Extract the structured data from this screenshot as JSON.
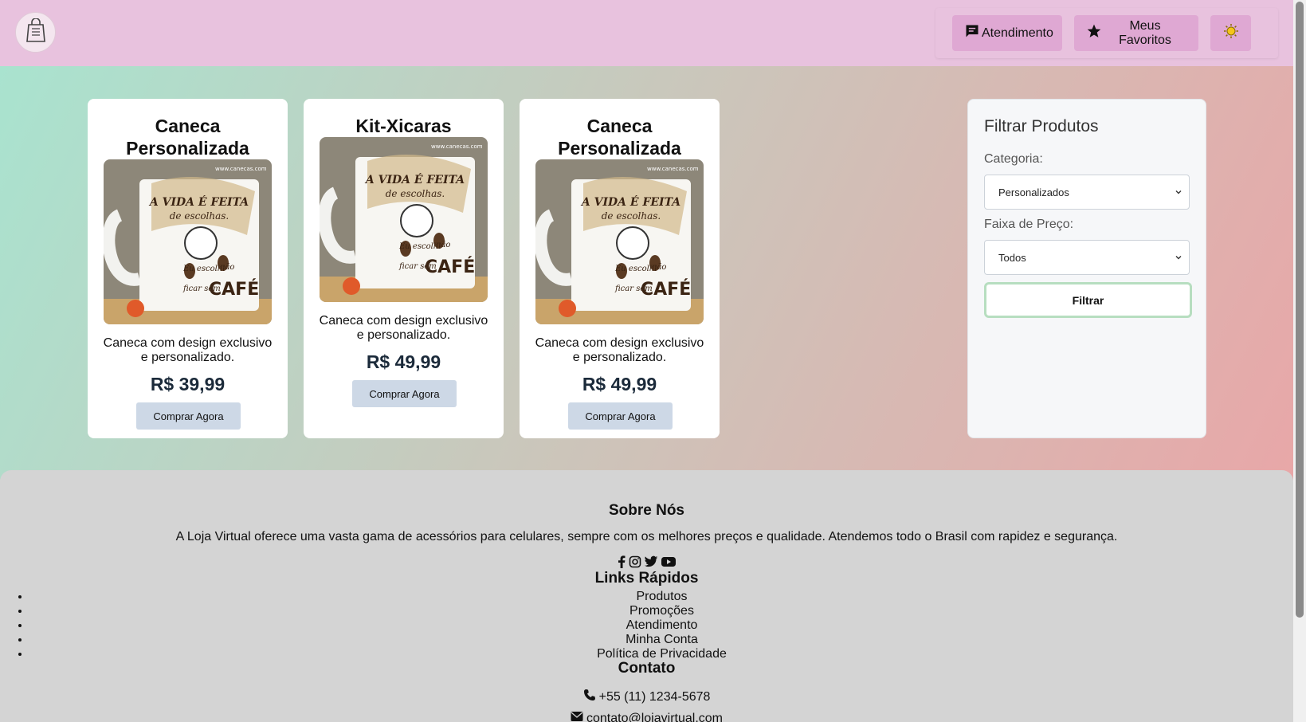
{
  "header": {
    "logo_icon": "shopping-bag-icon",
    "nav": [
      {
        "label": "Atendimento",
        "icon": "chat-icon"
      },
      {
        "label": "Meus Favoritos",
        "icon": "star-icon"
      },
      {
        "label": "",
        "icon": "sun-icon"
      }
    ]
  },
  "products": [
    {
      "title": "Caneca Personalizada",
      "description": "Caneca com design exclusivo e personalizado.",
      "price": "R$ 39,99",
      "button": "Comprar Agora"
    },
    {
      "title": "Kit-Xicaras",
      "description": "Caneca com design exclusivo e personalizado.",
      "price": "R$ 49,99",
      "button": "Comprar Agora"
    },
    {
      "title": "Caneca Personalizada",
      "description": "Caneca com design exclusivo e personalizado.",
      "price": "R$ 49,99",
      "button": "Comprar Agora"
    }
  ],
  "mug_text": {
    "line1": "A VIDA É FEITA",
    "line2": "de escolhas.",
    "line3": "Eu escolhi",
    "line4": "não",
    "line5": "ficar sem",
    "line6": "CAFÉ",
    "site": "www.canecas.com"
  },
  "filter": {
    "title": "Filtrar Produtos",
    "category_label": "Categoria:",
    "category_value": "Personalizados",
    "price_label": "Faixa de Preço:",
    "price_value": "Todos",
    "button": "Filtrar"
  },
  "footer": {
    "about_title": "Sobre Nós",
    "about_text": "A Loja Virtual oferece uma vasta gama de acessórios para celulares, sempre com os melhores preços e qualidade. Atendemos todo o Brasil com rapidez e segurança.",
    "social_icons": [
      "facebook-icon",
      "instagram-icon",
      "twitter-icon",
      "youtube-icon"
    ],
    "links_title": "Links Rápidos",
    "links": [
      "Produtos",
      "Promoções",
      "Atendimento",
      "Minha Conta",
      "Política de Privacidade"
    ],
    "contact_title": "Contato",
    "phone": "+55 (11) 1234-5678",
    "email": "contato@lojavirtual.com"
  },
  "colors": {
    "header_bg": "#e8c2de",
    "nav_button_bg": "#dfa8d3",
    "buy_button_bg": "#cdd8e6",
    "footer_bg": "#d4d4d4",
    "filter_button_border": "#b7dec0"
  }
}
